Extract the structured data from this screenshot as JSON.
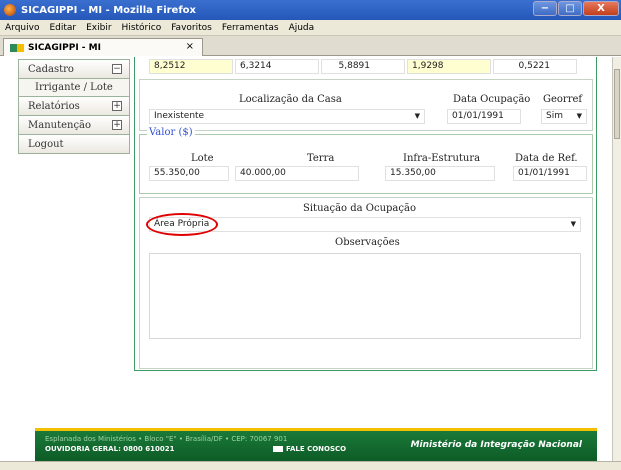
{
  "window": {
    "title": "SICAGIPPI - MI - Mozilla Firefox",
    "controls": [
      "−",
      "□",
      "X"
    ]
  },
  "menu": [
    "Arquivo",
    "Editar",
    "Exibir",
    "Histórico",
    "Favoritos",
    "Ferramentas",
    "Ajuda"
  ],
  "tab": {
    "label": "SICAGIPPI - MI",
    "close": "×"
  },
  "nav": {
    "cadastro": "Cadastro",
    "irrigante": "Irrigante / Lote",
    "relatorios": "Relatórios",
    "manutencao": "Manutenção",
    "logout": "Logout",
    "collapse_glyph": "−",
    "expand_glyph": "+"
  },
  "top_row": [
    "8,2512",
    "6,3214",
    "5,8891",
    "1,9298",
    "0,5221"
  ],
  "localizacao": {
    "label": "Localização da Casa",
    "value": "Inexistente"
  },
  "data_ocupacao": {
    "label": "Data Ocupação",
    "value": "01/01/1991"
  },
  "georref": {
    "label": "Georref",
    "value": "Sim"
  },
  "valor": {
    "legend": "Valor ($)",
    "lote_label": "Lote",
    "lote": "55.350,00",
    "terra_label": "Terra",
    "terra": "40.000,00",
    "infra_label": "Infra-Estrutura",
    "infra": "15.350,00",
    "dataref_label": "Data de Ref.",
    "dataref": "01/01/1991"
  },
  "situacao": {
    "label": "Situação da Ocupação",
    "value": "Área Própria"
  },
  "observacoes": {
    "label": "Observações"
  },
  "footer": {
    "address": "Esplanada dos Ministérios • Bloco \"E\" • Brasília/DF • CEP: 70067 901",
    "ouvidoria": "OUVIDORIA GERAL: 0800 610021",
    "fale": "FALE CONOSCO",
    "ministerio": "Ministério da Integração Nacional"
  },
  "colors": {
    "panel_border": "#3c9a64",
    "footer_green": "#1b7d3a",
    "highlight": "#e00000"
  },
  "icons": [
    "firefox-icon",
    "favicon-icon",
    "envelope-icon"
  ]
}
